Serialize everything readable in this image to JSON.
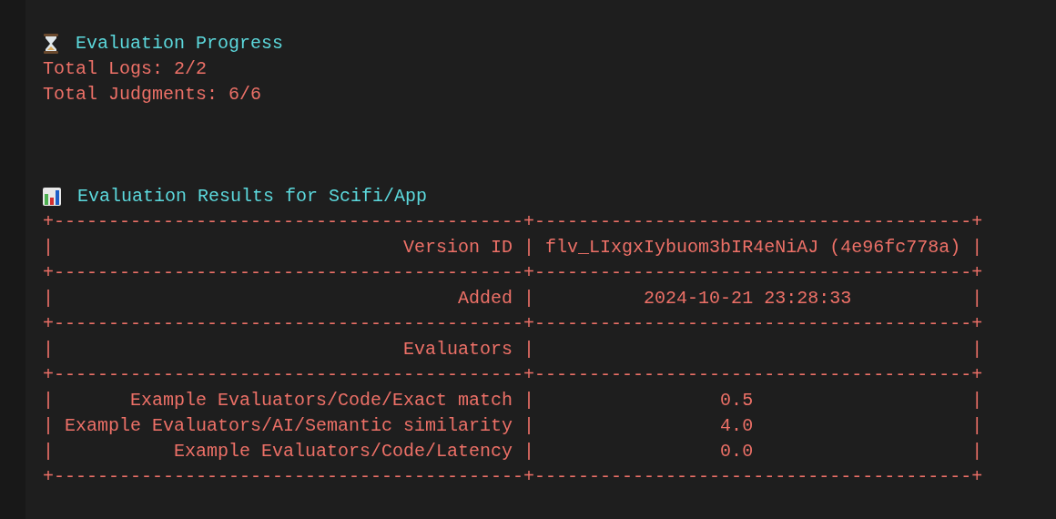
{
  "progress": {
    "title": "Evaluation Progress",
    "lines": [
      "Total Logs: 2/2",
      "Total Judgments: 6/6"
    ]
  },
  "results": {
    "title": "Evaluation Results for Scifi/App",
    "table": [
      "+-------------------------------------------+----------------------------------------+",
      "|                                Version ID | flv_LIxgxIybuom3bIR4eNiAJ (4e96fc778a) |",
      "+-------------------------------------------+----------------------------------------+",
      "|                                     Added |          2024-10-21 23:28:33           |",
      "+-------------------------------------------+----------------------------------------+",
      "|                                Evaluators |                                        |",
      "+-------------------------------------------+----------------------------------------+",
      "|       Example Evaluators/Code/Exact match |                 0.5                    |",
      "| Example Evaluators/AI/Semantic similarity |                 4.0                    |",
      "|           Example Evaluators/Code/Latency |                 0.0                    |",
      "+-------------------------------------------+----------------------------------------+"
    ]
  }
}
